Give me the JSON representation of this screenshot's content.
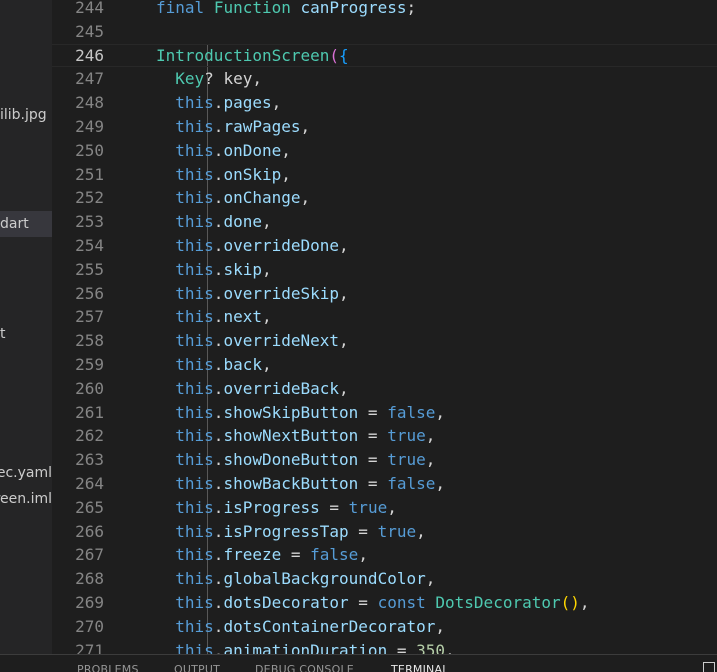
{
  "sidebar": {
    "items": [
      {
        "label": "ilib.jpg",
        "selected": false
      },
      {
        "label": "dart",
        "selected": true
      },
      {
        "label": "t",
        "selected": false
      },
      {
        "label": "pubspec.yaml",
        "selected": false
      },
      {
        "label": "introduction_screen.iml",
        "selected": false
      }
    ]
  },
  "editor": {
    "current_line": 246,
    "lines": [
      {
        "n": "244",
        "tokens": [
          [
            "kw",
            "final"
          ],
          [
            "plain",
            " "
          ],
          [
            "type",
            "Function"
          ],
          [
            "plain",
            " "
          ],
          [
            "prop",
            "canProgress"
          ],
          [
            "plain",
            ";"
          ]
        ]
      },
      {
        "n": "245",
        "tokens": []
      },
      {
        "n": "246",
        "tokens": [
          [
            "type",
            "IntroductionScreen"
          ],
          [
            "paren",
            "("
          ],
          [
            "brace",
            "{"
          ]
        ]
      },
      {
        "n": "247",
        "tokens": [
          [
            "plain",
            "  "
          ],
          [
            "type",
            "Key"
          ],
          [
            "plain",
            "? key,"
          ]
        ]
      },
      {
        "n": "248",
        "tokens": [
          [
            "plain",
            "  "
          ],
          [
            "kw",
            "this"
          ],
          [
            "plain",
            "."
          ],
          [
            "prop",
            "pages"
          ],
          [
            "plain",
            ","
          ]
        ]
      },
      {
        "n": "249",
        "tokens": [
          [
            "plain",
            "  "
          ],
          [
            "kw",
            "this"
          ],
          [
            "plain",
            "."
          ],
          [
            "prop",
            "rawPages"
          ],
          [
            "plain",
            ","
          ]
        ]
      },
      {
        "n": "250",
        "tokens": [
          [
            "plain",
            "  "
          ],
          [
            "kw",
            "this"
          ],
          [
            "plain",
            "."
          ],
          [
            "prop",
            "onDone"
          ],
          [
            "plain",
            ","
          ]
        ]
      },
      {
        "n": "251",
        "tokens": [
          [
            "plain",
            "  "
          ],
          [
            "kw",
            "this"
          ],
          [
            "plain",
            "."
          ],
          [
            "prop",
            "onSkip"
          ],
          [
            "plain",
            ","
          ]
        ]
      },
      {
        "n": "252",
        "tokens": [
          [
            "plain",
            "  "
          ],
          [
            "kw",
            "this"
          ],
          [
            "plain",
            "."
          ],
          [
            "prop",
            "onChange"
          ],
          [
            "plain",
            ","
          ]
        ]
      },
      {
        "n": "253",
        "tokens": [
          [
            "plain",
            "  "
          ],
          [
            "kw",
            "this"
          ],
          [
            "plain",
            "."
          ],
          [
            "prop",
            "done"
          ],
          [
            "plain",
            ","
          ]
        ]
      },
      {
        "n": "254",
        "tokens": [
          [
            "plain",
            "  "
          ],
          [
            "kw",
            "this"
          ],
          [
            "plain",
            "."
          ],
          [
            "prop",
            "overrideDone"
          ],
          [
            "plain",
            ","
          ]
        ]
      },
      {
        "n": "255",
        "tokens": [
          [
            "plain",
            "  "
          ],
          [
            "kw",
            "this"
          ],
          [
            "plain",
            "."
          ],
          [
            "prop",
            "skip"
          ],
          [
            "plain",
            ","
          ]
        ]
      },
      {
        "n": "256",
        "tokens": [
          [
            "plain",
            "  "
          ],
          [
            "kw",
            "this"
          ],
          [
            "plain",
            "."
          ],
          [
            "prop",
            "overrideSkip"
          ],
          [
            "plain",
            ","
          ]
        ]
      },
      {
        "n": "257",
        "tokens": [
          [
            "plain",
            "  "
          ],
          [
            "kw",
            "this"
          ],
          [
            "plain",
            "."
          ],
          [
            "prop",
            "next"
          ],
          [
            "plain",
            ","
          ]
        ]
      },
      {
        "n": "258",
        "tokens": [
          [
            "plain",
            "  "
          ],
          [
            "kw",
            "this"
          ],
          [
            "plain",
            "."
          ],
          [
            "prop",
            "overrideNext"
          ],
          [
            "plain",
            ","
          ]
        ]
      },
      {
        "n": "259",
        "tokens": [
          [
            "plain",
            "  "
          ],
          [
            "kw",
            "this"
          ],
          [
            "plain",
            "."
          ],
          [
            "prop",
            "back"
          ],
          [
            "plain",
            ","
          ]
        ]
      },
      {
        "n": "260",
        "tokens": [
          [
            "plain",
            "  "
          ],
          [
            "kw",
            "this"
          ],
          [
            "plain",
            "."
          ],
          [
            "prop",
            "overrideBack"
          ],
          [
            "plain",
            ","
          ]
        ]
      },
      {
        "n": "261",
        "tokens": [
          [
            "plain",
            "  "
          ],
          [
            "kw",
            "this"
          ],
          [
            "plain",
            "."
          ],
          [
            "prop",
            "showSkipButton"
          ],
          [
            "plain",
            " = "
          ],
          [
            "kw",
            "false"
          ],
          [
            "plain",
            ","
          ]
        ]
      },
      {
        "n": "262",
        "tokens": [
          [
            "plain",
            "  "
          ],
          [
            "kw",
            "this"
          ],
          [
            "plain",
            "."
          ],
          [
            "prop",
            "showNextButton"
          ],
          [
            "plain",
            " = "
          ],
          [
            "kw",
            "true"
          ],
          [
            "plain",
            ","
          ]
        ]
      },
      {
        "n": "263",
        "tokens": [
          [
            "plain",
            "  "
          ],
          [
            "kw",
            "this"
          ],
          [
            "plain",
            "."
          ],
          [
            "prop",
            "showDoneButton"
          ],
          [
            "plain",
            " = "
          ],
          [
            "kw",
            "true"
          ],
          [
            "plain",
            ","
          ]
        ]
      },
      {
        "n": "264",
        "tokens": [
          [
            "plain",
            "  "
          ],
          [
            "kw",
            "this"
          ],
          [
            "plain",
            "."
          ],
          [
            "prop",
            "showBackButton"
          ],
          [
            "plain",
            " = "
          ],
          [
            "kw",
            "false"
          ],
          [
            "plain",
            ","
          ]
        ]
      },
      {
        "n": "265",
        "tokens": [
          [
            "plain",
            "  "
          ],
          [
            "kw",
            "this"
          ],
          [
            "plain",
            "."
          ],
          [
            "prop",
            "isProgress"
          ],
          [
            "plain",
            " = "
          ],
          [
            "kw",
            "true"
          ],
          [
            "plain",
            ","
          ]
        ]
      },
      {
        "n": "266",
        "tokens": [
          [
            "plain",
            "  "
          ],
          [
            "kw",
            "this"
          ],
          [
            "plain",
            "."
          ],
          [
            "prop",
            "isProgressTap"
          ],
          [
            "plain",
            " = "
          ],
          [
            "kw",
            "true"
          ],
          [
            "plain",
            ","
          ]
        ]
      },
      {
        "n": "267",
        "tokens": [
          [
            "plain",
            "  "
          ],
          [
            "kw",
            "this"
          ],
          [
            "plain",
            "."
          ],
          [
            "prop",
            "freeze"
          ],
          [
            "plain",
            " = "
          ],
          [
            "kw",
            "false"
          ],
          [
            "plain",
            ","
          ]
        ]
      },
      {
        "n": "268",
        "tokens": [
          [
            "plain",
            "  "
          ],
          [
            "kw",
            "this"
          ],
          [
            "plain",
            "."
          ],
          [
            "prop",
            "globalBackgroundColor"
          ],
          [
            "plain",
            ","
          ]
        ]
      },
      {
        "n": "269",
        "tokens": [
          [
            "plain",
            "  "
          ],
          [
            "kw",
            "this"
          ],
          [
            "plain",
            "."
          ],
          [
            "prop",
            "dotsDecorator"
          ],
          [
            "plain",
            " = "
          ],
          [
            "kw",
            "const"
          ],
          [
            "plain",
            " "
          ],
          [
            "type",
            "DotsDecorator"
          ],
          [
            "paren2",
            "()"
          ],
          [
            "plain",
            ","
          ]
        ]
      },
      {
        "n": "270",
        "tokens": [
          [
            "plain",
            "  "
          ],
          [
            "kw",
            "this"
          ],
          [
            "plain",
            "."
          ],
          [
            "prop",
            "dotsContainerDecorator"
          ],
          [
            "plain",
            ","
          ]
        ]
      },
      {
        "n": "271",
        "tokens": [
          [
            "plain",
            "  "
          ],
          [
            "kw",
            "this"
          ],
          [
            "plain",
            "."
          ],
          [
            "prop",
            "animationDuration"
          ],
          [
            "plain",
            " = "
          ],
          [
            "num",
            "350"
          ],
          [
            "plain",
            ","
          ]
        ]
      }
    ]
  },
  "panel": {
    "tabs": [
      {
        "label": "PROBLEMS",
        "active": false
      },
      {
        "label": "OUTPUT",
        "active": false
      },
      {
        "label": "DEBUG CONSOLE",
        "active": false
      },
      {
        "label": "TERMINAL",
        "active": true
      }
    ]
  }
}
